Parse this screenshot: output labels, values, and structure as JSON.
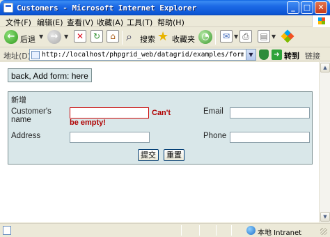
{
  "window": {
    "title": "Customers - Microsoft Internet Explorer",
    "controls": {
      "minimize": "_",
      "maximize": "□",
      "close": "✕"
    }
  },
  "menu": {
    "items": [
      "文件(F)",
      "编辑(E)",
      "查看(V)",
      "收藏(A)",
      "工具(T)",
      "帮助(H)"
    ]
  },
  "toolbar": {
    "back_label": "后退",
    "search_label": "搜索",
    "favorites_label": "收藏夹"
  },
  "address": {
    "label": "地址(D)",
    "url": "http://localhost/phpgrid_web/datagrid/examples/form_validate.php?d",
    "go_label": "转到",
    "links_label": "链接"
  },
  "nav": {
    "back_link": "back",
    "separator": ",",
    "text": "Add form:",
    "here_link": "here"
  },
  "form": {
    "legend": "新增",
    "fields": {
      "customer_name": {
        "label": "Customer's name",
        "value": ""
      },
      "email": {
        "label": "Email",
        "value": ""
      },
      "address": {
        "label": "Address",
        "value": ""
      },
      "phone": {
        "label": "Phone",
        "value": ""
      }
    },
    "error": "Can't be empty!",
    "submit_label": "提交",
    "reset_label": "重置"
  },
  "status": {
    "zone": "本地 Intranet"
  },
  "colors": {
    "panel_bg": "#d9e7e9",
    "error": "#b00000",
    "titlebar": "#0b55d4"
  }
}
